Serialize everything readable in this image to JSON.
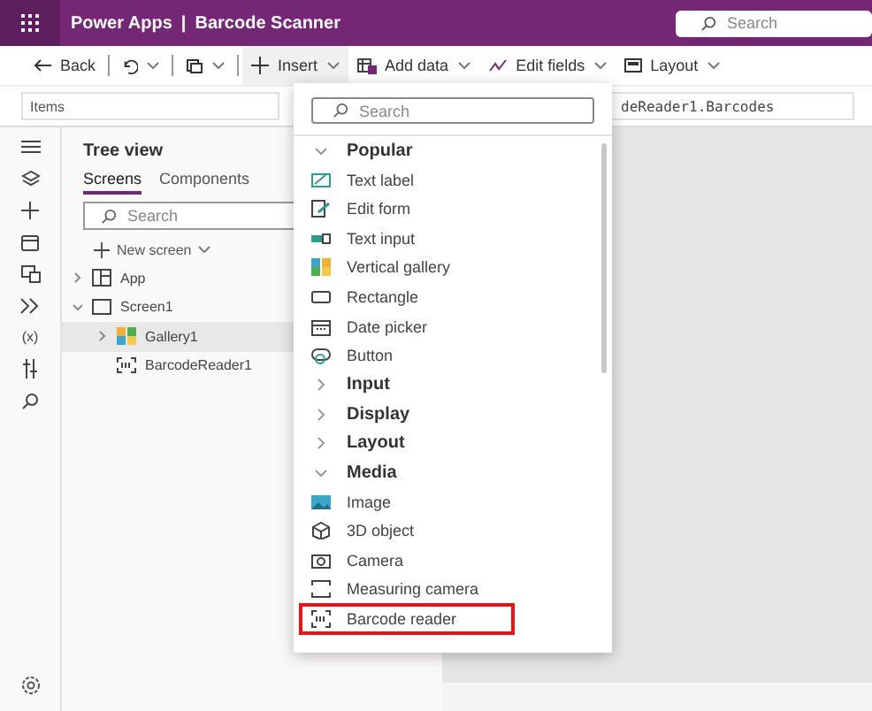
{
  "title_bar": {
    "app_name": "Power Apps",
    "separator": "|",
    "document": "Barcode Scanner",
    "search": {
      "placeholder": "Search"
    }
  },
  "toolbar": [
    {
      "kind": "back",
      "label": "Back",
      "active": false
    },
    {
      "kind": "undo",
      "active": false
    },
    {
      "kind": "copy",
      "active": false
    },
    {
      "kind": "insert",
      "label": "Insert",
      "active": true
    },
    {
      "kind": "data",
      "label": "Add data",
      "active": false
    },
    {
      "kind": "fields",
      "label": "Edit fields",
      "active": false
    },
    {
      "kind": "layout",
      "label": "Layout",
      "active": false
    }
  ],
  "formula_bar": {
    "property": "Items",
    "formula": "deReader1.Barcodes"
  },
  "rail": [
    {
      "kind": "menu"
    },
    {
      "kind": "layers"
    },
    {
      "kind": "plus"
    },
    {
      "kind": "data"
    },
    {
      "kind": "media"
    },
    {
      "kind": "flow"
    },
    {
      "kind": "variables",
      "glyph": "(x)"
    },
    {
      "kind": "tools"
    },
    {
      "kind": "search"
    }
  ],
  "rail_bottom": [
    {
      "kind": "settings"
    }
  ],
  "tree_view": {
    "title": "Tree view",
    "tabs": [
      {
        "label": "Screens",
        "selected": true
      },
      {
        "label": "Components",
        "selected": false
      }
    ],
    "search": {
      "placeholder": "Search"
    },
    "new_screen": "New screen",
    "nodes": [
      {
        "label": "App",
        "kind": "app",
        "expanded": false,
        "selected": false
      },
      {
        "label": "Screen1",
        "kind": "screen",
        "expanded": true,
        "selected": false,
        "children": [
          {
            "label": "Gallery1",
            "kind": "gallery",
            "expanded": false,
            "selected": true
          },
          {
            "label": "BarcodeReader1",
            "kind": "barcode",
            "selected": false
          }
        ]
      }
    ]
  },
  "insert_menu": {
    "search": {
      "placeholder": "Search"
    },
    "items": [
      {
        "kind": "group",
        "label": "Popular",
        "expanded": true
      },
      {
        "kind": "label",
        "label": "Text label",
        "highlighted": false
      },
      {
        "kind": "form",
        "label": "Edit form",
        "highlighted": false
      },
      {
        "kind": "input",
        "label": "Text input",
        "highlighted": false
      },
      {
        "kind": "gallery",
        "label": "Vertical gallery",
        "highlighted": false
      },
      {
        "kind": "rectangle",
        "label": "Rectangle",
        "highlighted": false
      },
      {
        "kind": "date",
        "label": "Date picker",
        "highlighted": false
      },
      {
        "kind": "button",
        "label": "Button",
        "highlighted": false
      },
      {
        "kind": "group",
        "label": "Input",
        "expanded": false
      },
      {
        "kind": "group",
        "label": "Display",
        "expanded": false
      },
      {
        "kind": "group",
        "label": "Layout",
        "expanded": false
      },
      {
        "kind": "group",
        "label": "Media",
        "expanded": true
      },
      {
        "kind": "image",
        "label": "Image",
        "highlighted": false
      },
      {
        "kind": "cube",
        "label": "3D object",
        "highlighted": false
      },
      {
        "kind": "camera",
        "label": "Camera",
        "highlighted": false
      },
      {
        "kind": "measure",
        "label": "Measuring camera",
        "highlighted": false
      },
      {
        "kind": "barcode",
        "label": "Barcode reader",
        "highlighted": true
      }
    ]
  }
}
